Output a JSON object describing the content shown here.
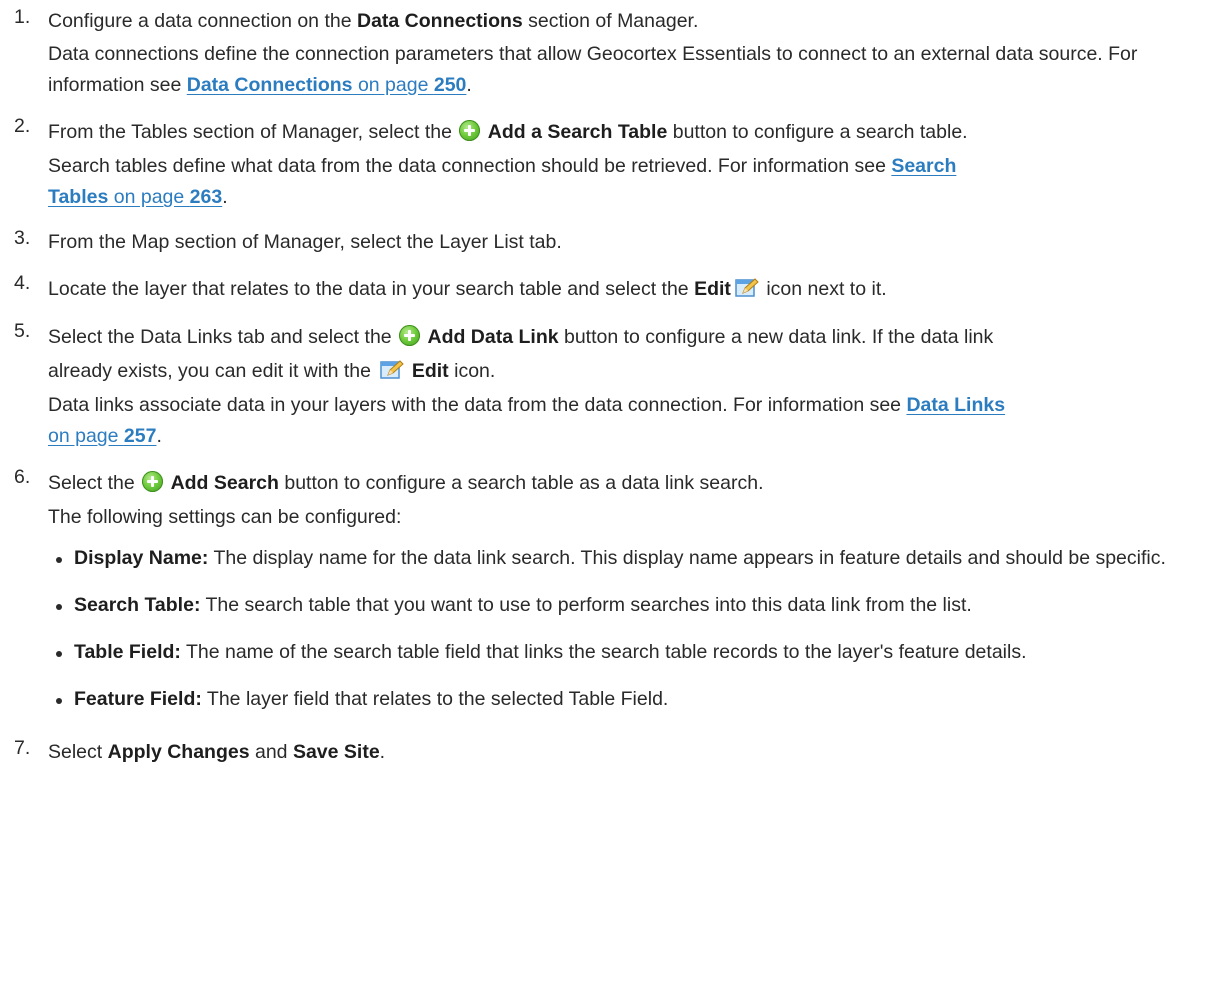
{
  "steps": [
    {
      "num": "1.",
      "pre": "Configure a data connection on the ",
      "bold": "Data Connections",
      "post": " section of Manager.",
      "desc": "Data connections define the connection parameters that allow Geocortex Essentials to connect to an external data source. For information see ",
      "link_bold": "Data Connections",
      "link_mid": " on page ",
      "link_page": "250",
      "desc_end": "."
    },
    {
      "num": "2.",
      "pre": "From the Tables section of Manager, select the ",
      "icon": "add-icon",
      "bold": "Add a Search Table",
      "post": " button to configure a search table.",
      "desc": "Search tables define what data from the data connection should be retrieved. For information see ",
      "link_bold_a": "Search",
      "link_bold_b": "Tables",
      "link_mid": " on page ",
      "link_page": "263",
      "desc_end": "."
    },
    {
      "num": "3.",
      "text": "From the Map section of Manager, select the Layer List tab."
    },
    {
      "num": "4.",
      "pre": "Locate the layer that relates to the data in your search table and select the ",
      "bold": "Edit",
      "icon": "edit-icon",
      "post": " icon next to it."
    },
    {
      "num": "5.",
      "pre": "Select the Data Links tab and select the ",
      "icon": "add-icon",
      "bold": "Add Data Link",
      "post": " button to configure a new data link. If the data link",
      "line2_pre": "already exists, you can edit it with the ",
      "line2_icon": "edit-icon",
      "line2_bold": "Edit",
      "line2_post": " icon.",
      "desc": "Data links associate data in your layers with the data from the data connection. For information see ",
      "link_bold": "Data Links",
      "link_mid": "on page ",
      "link_page": "257",
      "desc_end": "."
    },
    {
      "num": "6.",
      "pre": "Select the ",
      "icon": "add-icon",
      "bold": "Add Search",
      "post": " button to configure a search table as a data link search.",
      "desc": "The following settings can be configured:",
      "settings": [
        {
          "term": "Display Name:",
          "text": " The display name for the data link search. This display name appears in feature details and should be specific."
        },
        {
          "term": "Search Table:",
          "text": " The search table that you want to use to perform searches into this data link from the list."
        },
        {
          "term": "Table Field:",
          "text": " The name of the search table field that links the search table records to the layer's feature details."
        },
        {
          "term": "Feature Field:",
          "text": " The layer field that relates to the selected Table Field."
        }
      ]
    },
    {
      "num": "7.",
      "pre": "Select ",
      "bold1": "Apply Changes",
      "mid": " and ",
      "bold2": "Save Site",
      "post": "."
    }
  ]
}
